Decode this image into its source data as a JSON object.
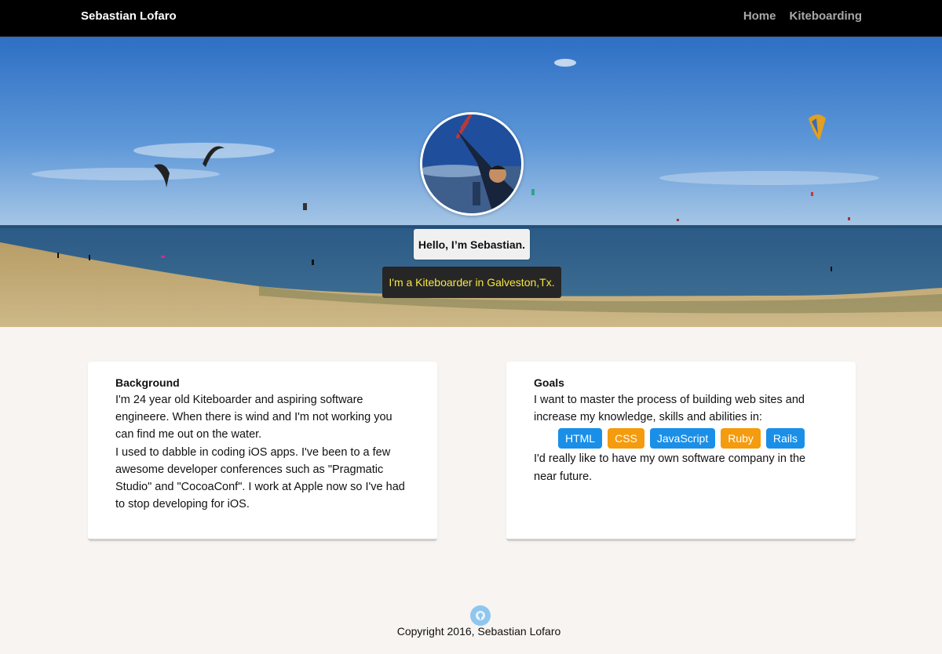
{
  "nav": {
    "brand": "Sebastian Lofaro",
    "links": [
      {
        "label": "Home"
      },
      {
        "label": "Kiteboarding"
      }
    ]
  },
  "hero": {
    "greeting": "Hello, I’m Sebastian.",
    "tagline": "I'm a Kiteboarder in Galveston,Tx."
  },
  "background": {
    "title": "Background",
    "paragraph1": "I'm 24 year old Kiteboarder and aspiring software engineere. When there is wind and I'm not working you can find me out on the water.",
    "paragraph2": "I used to dabble in coding iOS apps. I've been to a few awesome developer conferences such as \"Pragmatic Studio\" and \"CocoaConf\". I work at Apple now so I've had to stop developing for iOS."
  },
  "goals": {
    "title": "Goals",
    "intro": "I want to master the process of building web sites and increase my knowledge, skills and abilities in:",
    "skills": [
      {
        "label": "HTML",
        "color": "#1a8fe8"
      },
      {
        "label": "CSS",
        "color": "#f59b0e"
      },
      {
        "label": "JavaScript",
        "color": "#1a8fe8"
      },
      {
        "label": "Ruby",
        "color": "#f59b0e"
      },
      {
        "label": "Rails",
        "color": "#1a8fe8"
      }
    ],
    "outro": "I'd really like to have my own software company in the near future."
  },
  "footer": {
    "icon": "github-icon",
    "copyright": "Copyright 2016, Sebastian Lofaro"
  }
}
